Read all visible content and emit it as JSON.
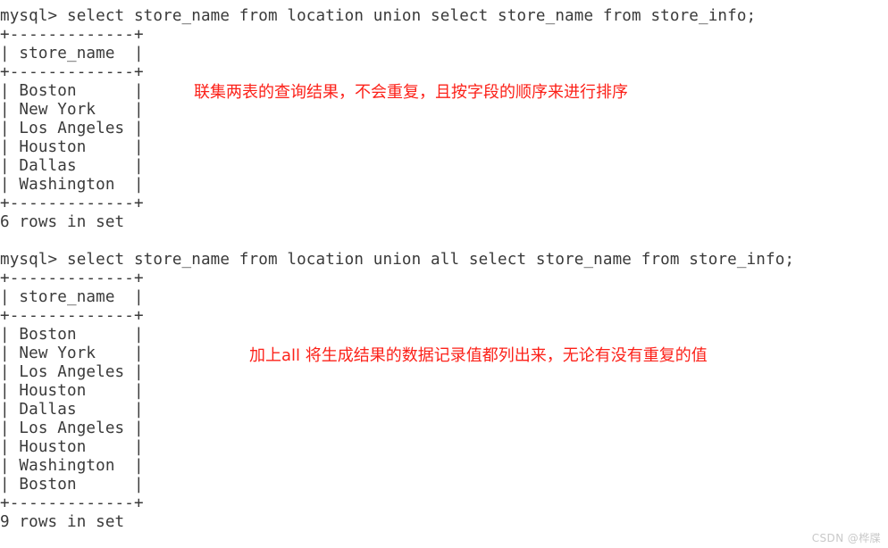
{
  "terminal": {
    "prompt": "mysql>",
    "blocks": [
      {
        "name": "union-query-block",
        "command": "mysql> select store_name from location union select store_name from store_info;",
        "table_top_border": "+-------------+",
        "header_row": "| store_name  |",
        "header_separator": "+-------------+",
        "rows": [
          "| Boston      |",
          "| New York    |",
          "| Los Angeles |",
          "| Houston     |",
          "| Dallas      |",
          "| Washington  |"
        ],
        "table_bottom_border": "+-------------+",
        "status": "6 rows in set"
      },
      {
        "name": "union-all-query-block",
        "command": "mysql> select store_name from location union all select store_name from store_info;",
        "table_top_border": "+-------------+",
        "header_row": "| store_name  |",
        "header_separator": "+-------------+",
        "rows": [
          "| Boston      |",
          "| New York    |",
          "| Los Angeles |",
          "| Houston     |",
          "| Dallas      |",
          "| Los Angeles |",
          "| Houston     |",
          "| Washington  |",
          "| Boston      |"
        ],
        "table_bottom_border": "+-------------+",
        "status": "9 rows in set"
      }
    ],
    "column_header": "store_name",
    "result_values_union": [
      "Boston",
      "New York",
      "Los Angeles",
      "Houston",
      "Dallas",
      "Washington"
    ],
    "result_values_union_all": [
      "Boston",
      "New York",
      "Los Angeles",
      "Houston",
      "Dallas",
      "Los Angeles",
      "Houston",
      "Washington",
      "Boston"
    ]
  },
  "annotations": [
    {
      "id": "union-note",
      "text": "联集两表的查询结果，不会重复，且按字段的顺序来进行排序",
      "color": "#fc2119"
    },
    {
      "id": "union-all-note",
      "text": "加上all 将生成结果的数据记录值都列出来，无论有没有重复的值",
      "color": "#fc2119"
    }
  ],
  "watermark": {
    "text": "CSDN @桦牒"
  },
  "colors": {
    "background": "#ffffff",
    "terminal_text": "#3a3a3a",
    "annotation_red": "#fc2119",
    "watermark_gray": "#c9c9c9"
  }
}
